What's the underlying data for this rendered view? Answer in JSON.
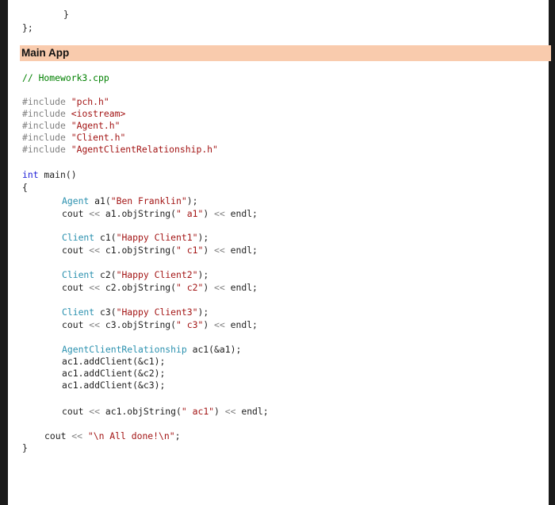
{
  "heading": "Main App",
  "code": {
    "top_brace": "}",
    "end_class": "};",
    "comment": "// Homework3.cpp",
    "include_kw": "#include",
    "inc1": "\"pch.h\"",
    "inc2": "<iostream>",
    "inc3": "\"Agent.h\"",
    "inc4": "\"Client.h\"",
    "inc5": "\"AgentClientRelationship.h\"",
    "int_kw": "int",
    "main_sig": " main()",
    "open_brace": "{",
    "close_brace": "}",
    "type_agent": "Agent",
    "type_client": "Client",
    "type_acr": "AgentClientRelationship",
    "a1_decl": " a1(",
    "a1_name": "\"Ben Franklin\"",
    "decl_end": ");",
    "cout": "cout ",
    "shl": "<<",
    "a1_call": " a1.objString(",
    "a1_label": "\" a1\"",
    "endl": " endl;",
    "call_close": ") ",
    "c1_decl": " c1(",
    "c1_name": "\"Happy Client1\"",
    "c1_call": " c1.objString(",
    "c1_label": "\" c1\"",
    "c2_decl": " c2(",
    "c2_name": "\"Happy Client2\"",
    "c2_call": " c2.objString(",
    "c2_label": "\" c2\"",
    "c3_decl": " c3(",
    "c3_name": "\"Happy Client3\"",
    "c3_call": " c3.objString(",
    "c3_label": "\" c3\"",
    "ac1_decl": " ac1(&a1);",
    "add1": "ac1.addClient(&c1);",
    "add2": "ac1.addClient(&c2);",
    "add3": "ac1.addClient(&c3);",
    "ac1_call": " ac1.objString(",
    "ac1_label": "\" ac1\"",
    "done_str": "\"\\n All done!\\n\"",
    "semi": ";"
  }
}
